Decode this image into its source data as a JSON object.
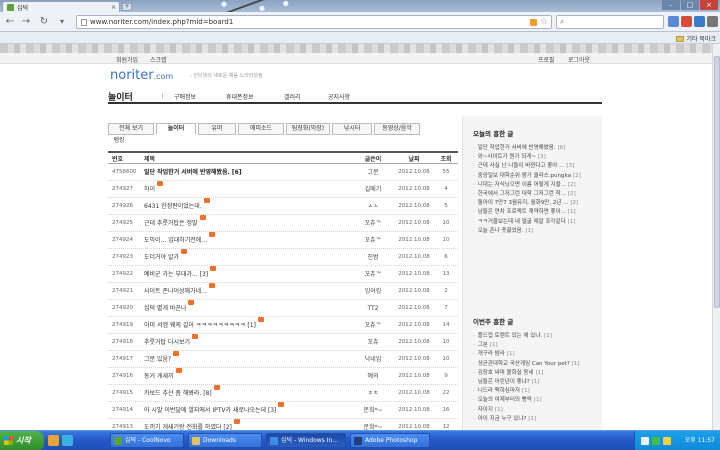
{
  "browser": {
    "tab_title": "십덕",
    "tab_close": "×",
    "new_tab": "+",
    "url": "www.noriter.com/index.php?mid=board1",
    "bookmarks_label": "기타 북마크",
    "nav": {
      "back": "←",
      "forward": "→",
      "reload": "↻"
    }
  },
  "page": {
    "util_left": [
      "회원가입",
      "스크랩"
    ],
    "util_right": [
      "프로필",
      "로그아웃"
    ],
    "logo": "noriter",
    "logo_suffix": ".com",
    "slogan": "- 인터넷의 새로운 채움 노리터닷컴",
    "main_nav": {
      "home": "놀이터",
      "items": [
        "구매정보",
        "휴대폰정보",
        "갤러리",
        "공지사항"
      ]
    },
    "sub_tabs_row1": [
      "전체 보기",
      "놀이터",
      "유머",
      "에피소드",
      "팀장화(막장)",
      "낚시터",
      "동영상/음악"
    ],
    "sub_tabs_row2": [
      "랭킹"
    ],
    "active_tab": "놀이터",
    "table": {
      "headers": {
        "no": "번호",
        "title": "제목",
        "author": "글쓴이",
        "date": "날짜",
        "views": "조회"
      },
      "rows": [
        {
          "no": "4756600",
          "title": "일단 작업한거 서버에 반영해봤음. [6]",
          "author": "그분",
          "date": "2012.10.08",
          "views": "55",
          "notice": true,
          "new": false
        },
        {
          "no": "274927",
          "title": "하이",
          "author": "길메기",
          "date": "2012.10.08",
          "views": "4",
          "notice": false,
          "new": true
        },
        {
          "no": "274926",
          "title": "6431 한정판이었는데.",
          "author": "ㅅㅅ",
          "date": "2012.10.08",
          "views": "5",
          "notice": false,
          "new": true
        },
        {
          "no": "274925",
          "title": "근데 추룻거탑은 정말",
          "author": "꼬츄™",
          "date": "2012.10.08",
          "views": "10",
          "notice": false,
          "new": true
        },
        {
          "no": "274924",
          "title": "도믹이... 입대하기전에...",
          "author": "꼬츄™",
          "date": "2012.10.08",
          "views": "10",
          "notice": false,
          "new": true
        },
        {
          "no": "274923",
          "title": "도더거야 알가",
          "author": "진범",
          "date": "2012.10.08",
          "views": "6",
          "notice": false,
          "new": true
        },
        {
          "no": "274922",
          "title": "예비군 가는 부대가... [3]",
          "author": "꼬츄™",
          "date": "2012.10.08",
          "views": "13",
          "notice": false,
          "new": true
        },
        {
          "no": "274921",
          "title": "사이트 존나이상해가네...",
          "author": "잉어킹",
          "date": "2012.10.08",
          "views": "2",
          "notice": false,
          "new": true
        },
        {
          "no": "274920",
          "title": "십덕 볕게 바꾼나",
          "author": "TT2",
          "date": "2012.10.08",
          "views": "7",
          "notice": false,
          "new": true
        },
        {
          "no": "274919",
          "title": "이미 서엠 웨케 길어 ㅋㅋㅋㅋㅋㅋㅋㅋㅋ [1]",
          "author": "꼬츄™",
          "date": "2012.10.08",
          "views": "14",
          "notice": false,
          "new": true
        },
        {
          "no": "274918",
          "title": "추룻거탑 다시보기",
          "author": "꼬츄",
          "date": "2012.10.08",
          "views": "10",
          "notice": false,
          "new": true
        },
        {
          "no": "274917",
          "title": "그분 있음?",
          "author": "낙네임",
          "date": "2012.10.08",
          "views": "10",
          "notice": false,
          "new": true
        },
        {
          "no": "274916",
          "title": "동거 게새끼",
          "author": "예의",
          "date": "2012.10.08",
          "views": "9",
          "notice": false,
          "new": true
        },
        {
          "no": "274915",
          "title": "카보드 추산 좀 해봐라. [8]",
          "author": "ㅊㅊ",
          "date": "2012.10.08",
          "views": "22",
          "notice": false,
          "new": true
        },
        {
          "no": "274914",
          "title": "아 시발 이번달에 열지에서 IPTV가 새로나오는데 [3]",
          "author": "문희*~",
          "date": "2012.10.08",
          "views": "16",
          "notice": false,
          "new": true
        },
        {
          "no": "274913",
          "title": "도끼기 게새기랑 전화를 하였다 [2]",
          "author": "문희*~",
          "date": "2012.10.08",
          "views": "12",
          "notice": false,
          "new": true
        }
      ]
    },
    "sidebar": {
      "today_title": "오늘의 흥한 글",
      "today_items": [
        {
          "text": "일단 작업한거 서버에 반영해봤음.",
          "count": "[6]"
        },
        {
          "text": "와~사이트가 뭔가 되게~",
          "count": "[3]"
        },
        {
          "text": "근데 사실 난 니들이 바뀐다고 좋아 ...",
          "count": "[3]"
        },
        {
          "text": "중앙일보 대학순위 왕가 클라스.pungka",
          "count": "[2]"
        },
        {
          "text": "니대는 자식닝으면 이름 어떻게 지을...",
          "count": "[2]"
        },
        {
          "text": "한국에서 그저그런 대학 그저그런 학...",
          "count": "[2]"
        },
        {
          "text": "돌아이 7만7 3월유지, 월화9만, 2년 ...",
          "count": "[2]"
        },
        {
          "text": "남들은 연차 프로젝트 계약하면 좋아...",
          "count": "[1]"
        },
        {
          "text": "ㅋㅋ거울보는데 내 얼굴 레알 조각같다",
          "count": "[1]"
        },
        {
          "text": "오늘 존나 춧끓었음.",
          "count": "[1]"
        }
      ],
      "week_title": "이번주 흥한 글",
      "week_items": [
        {
          "text": "플드컵 토렌트 있는 애 있냐.",
          "count": "[1]"
        },
        {
          "text": "그분",
          "count": "[1]"
        },
        {
          "text": "개구라 밤라",
          "count": "[1]"
        },
        {
          "text": "성균관대학교 국산게임 Can Your pet?",
          "count": "[1]"
        },
        {
          "text": "김장호 싸며 볼화실 동네",
          "count": "[1]"
        },
        {
          "text": "님들은 어린년이 좋냐?",
          "count": "[1]"
        },
        {
          "text": "니드라 맥하심마저",
          "count": "[1]"
        },
        {
          "text": "오늘의 여제부터의 빵력",
          "count": "[1]"
        },
        {
          "text": "자이지",
          "count": "[1]"
        },
        {
          "text": "아이 지금 누구 있냐?",
          "count": "[1]"
        }
      ]
    }
  },
  "taskbar": {
    "start": "시작",
    "tasks": [
      "십덕 - CoolNovo",
      "Downloads",
      "십덕 - Windows In...",
      "Adobe Photoshop"
    ],
    "clock": "오후 11:57"
  },
  "colors": {
    "logo": "#3a71c1",
    "new_badge": "#f0712a",
    "taskbar": "#2559c7"
  }
}
